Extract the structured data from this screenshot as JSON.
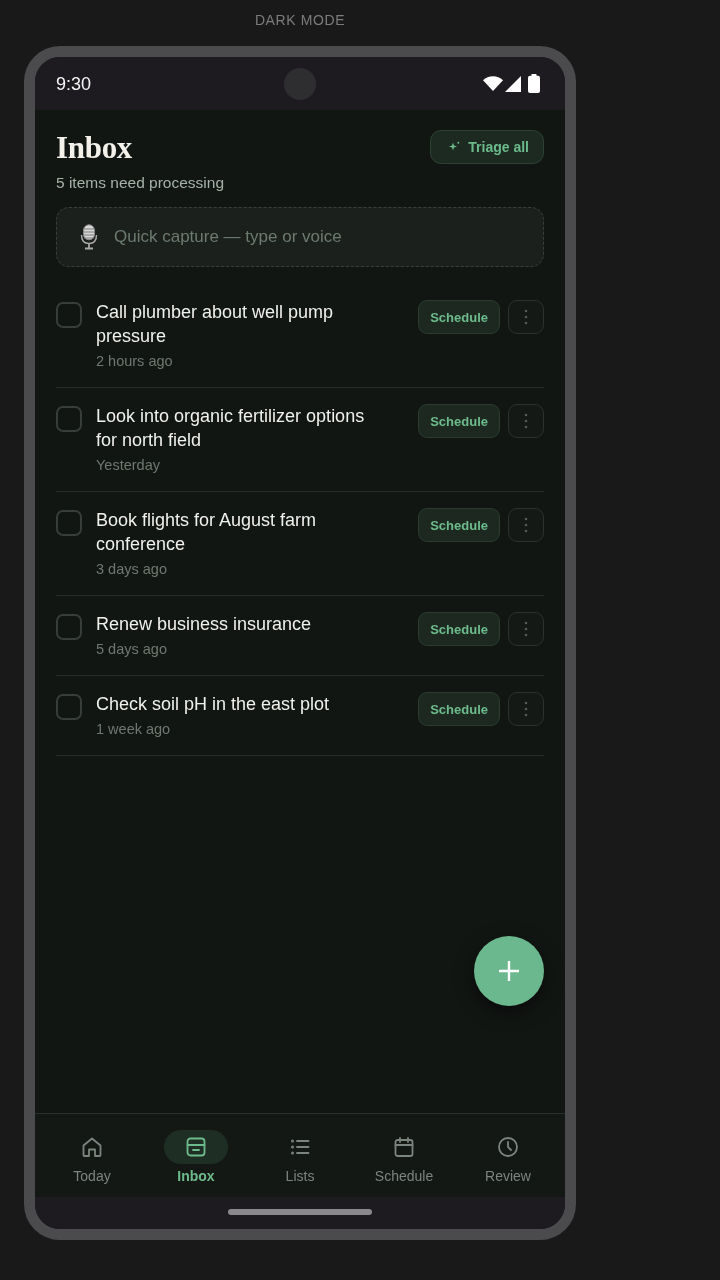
{
  "caption": "DARK MODE",
  "status_bar": {
    "time": "9:30"
  },
  "header": {
    "title": "Inbox",
    "subtitle": "5 items need processing",
    "action": "Triage all"
  },
  "quick_capture": {
    "placeholder": "Quick capture — type or voice"
  },
  "items": [
    {
      "title": "Call plumber about well pump pressure",
      "time": "2 hours ago",
      "checked": false,
      "action": "Schedule"
    },
    {
      "title": "Look into organic fertilizer options for north field",
      "time": "Yesterday",
      "checked": false,
      "action": "Schedule"
    },
    {
      "title": "Book flights for August farm conference",
      "time": "3 days ago",
      "checked": false,
      "action": "Schedule"
    },
    {
      "title": "Renew business insurance",
      "time": "5 days ago",
      "checked": false,
      "action": "Schedule"
    },
    {
      "title": "Check soil pH in the east plot",
      "time": "1 week ago",
      "checked": false,
      "action": "Schedule"
    }
  ],
  "bottom_nav": [
    {
      "label": "Today",
      "selected": false
    },
    {
      "label": "Inbox",
      "selected": true
    },
    {
      "label": "Lists",
      "selected": false
    },
    {
      "label": "Schedule",
      "selected": false
    },
    {
      "label": "Review",
      "selected": false
    }
  ]
}
